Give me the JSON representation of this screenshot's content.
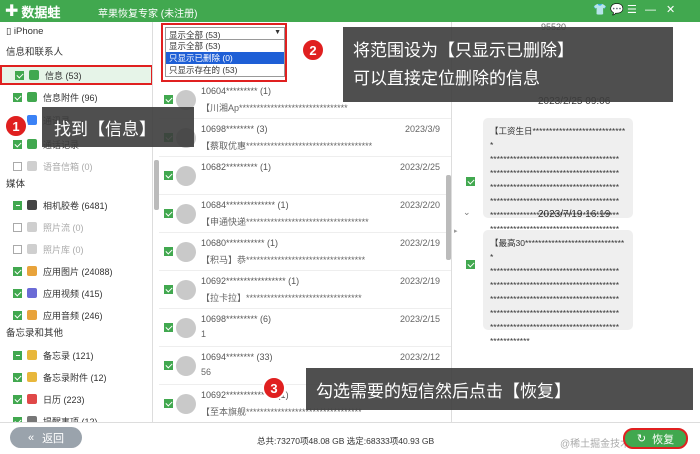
{
  "app": {
    "logo_text": "数据蛙",
    "title": "苹果恢复专家 (未注册)"
  },
  "window_controls": [
    "👕",
    "💬",
    "☰",
    "—",
    "✕"
  ],
  "sidebar": {
    "device": "iPhone",
    "sections": [
      {
        "title": "信息和联系人",
        "items": [
          {
            "label": "信息 (53)",
            "state": "on",
            "icon": "#41a84f",
            "selected": true
          },
          {
            "label": "信息附件 (96)",
            "state": "on",
            "icon": "#41a84f"
          },
          {
            "label": "通讯录",
            "state": "on",
            "icon": "#3b82f6"
          },
          {
            "label": "通话记录",
            "state": "on",
            "icon": "#41a84f"
          },
          {
            "label": "语音信箱 (0)",
            "state": "off",
            "icon": "#cfcfcf",
            "dim": true
          }
        ]
      },
      {
        "title": "媒体",
        "items": [
          {
            "label": "相机胶卷 (6481)",
            "state": "half",
            "icon": "#444"
          },
          {
            "label": "照片流 (0)",
            "state": "off",
            "icon": "#cfcfcf",
            "dim": true
          },
          {
            "label": "照片库 (0)",
            "state": "off",
            "icon": "#cfcfcf",
            "dim": true
          },
          {
            "label": "应用图片 (24088)",
            "state": "on",
            "icon": "#e8a33b"
          },
          {
            "label": "应用视频 (415)",
            "state": "on",
            "icon": "#6b6bd6"
          },
          {
            "label": "应用音频 (246)",
            "state": "on",
            "icon": "#e8a33b"
          }
        ]
      },
      {
        "title": "备忘录和其他",
        "items": [
          {
            "label": "备忘录 (121)",
            "state": "half",
            "icon": "#e8b73b"
          },
          {
            "label": "备忘录附件 (12)",
            "state": "on",
            "icon": "#e8b73b"
          },
          {
            "label": "日历 (223)",
            "state": "on",
            "icon": "#e04848"
          },
          {
            "label": "提醒事项 (12)",
            "state": "on",
            "icon": "#777"
          }
        ]
      }
    ]
  },
  "filter": {
    "selected": "显示全部 (53)",
    "options": [
      "显示全部 (53)",
      "只显示已删除 (0)",
      "只显示存在的 (53)"
    ],
    "highlighted": 1
  },
  "messages": [
    {
      "name": "10604********* (1)",
      "preview": "【川湘Ap*******************************",
      "date": ""
    },
    {
      "name": "10698******** (3)",
      "preview": "【蔡取优惠************************************",
      "date": "2023/3/9"
    },
    {
      "name": "10682********* (1)",
      "preview": "",
      "date": "2023/2/25"
    },
    {
      "name": "10684************** (1)",
      "preview": "【申通快递***********************************",
      "date": "2023/2/20"
    },
    {
      "name": "10680*********** (1)",
      "preview": "【积马】恭**********************************",
      "date": "2023/2/19"
    },
    {
      "name": "10692***************** (1)",
      "preview": "【拉卡拉】*********************************",
      "date": "2023/2/19"
    },
    {
      "name": "10698********* (6)",
      "preview": "1",
      "date": "2023/2/15"
    },
    {
      "name": "10694******** (33)",
      "preview": "56",
      "date": "2023/2/12"
    },
    {
      "name": "10692************** (1)",
      "preview": "【至本旗舰*********************************",
      "date": "2023/2/10"
    },
    {
      "name": "10658******** (1)",
      "preview": "",
      "date": "2023/1/13"
    }
  ],
  "detail": {
    "top_text": "95520",
    "conversations": [
      {
        "time": "2023/2/25 09:06",
        "text": "【工资生日*****************************\n***************************************\n***************************************\n***************************************\n***************************************\n***************************************\n***************************************\n**************************"
      },
      {
        "time": "2023/7/19 16:19",
        "text": "【最高30*******************************\n***************************************\n***************************************\n***************************************\n***************************************\n***************************************\n************"
      }
    ]
  },
  "bottom": {
    "back": "返回",
    "back_icon": "«",
    "stats": "总共:73270项48.08 GB 选定:68333项40.93 GB",
    "recover": "恢复",
    "recover_icon": "↻",
    "watermark": "@稀土掘金技术社区"
  },
  "callouts": [
    {
      "num": "1",
      "text": "找到【信息】"
    },
    {
      "num": "2",
      "text": "将范围设为【只显示已删除】\n可以直接定位删除的信息"
    },
    {
      "num": "3",
      "text": "勾选需要的短信然后点击【恢复】"
    }
  ]
}
